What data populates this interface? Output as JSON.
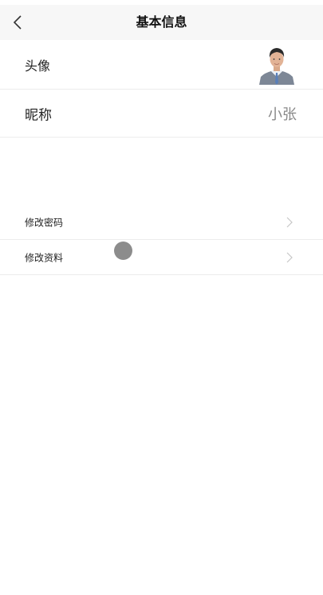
{
  "header": {
    "title": "基本信息",
    "back_icon": "chevron-left-icon"
  },
  "profile": {
    "avatar_label": "头像",
    "nickname_label": "昵称",
    "nickname_value": "小张"
  },
  "menu": [
    {
      "label": "修改密码",
      "icon": "chevron-right-icon"
    },
    {
      "label": "修改资料",
      "icon": "chevron-right-icon"
    }
  ],
  "colors": {
    "nav_background": "#f7f7f7",
    "divider": "#ececec",
    "secondary_text": "#888888",
    "touch_indicator": "#8c8c8c"
  }
}
